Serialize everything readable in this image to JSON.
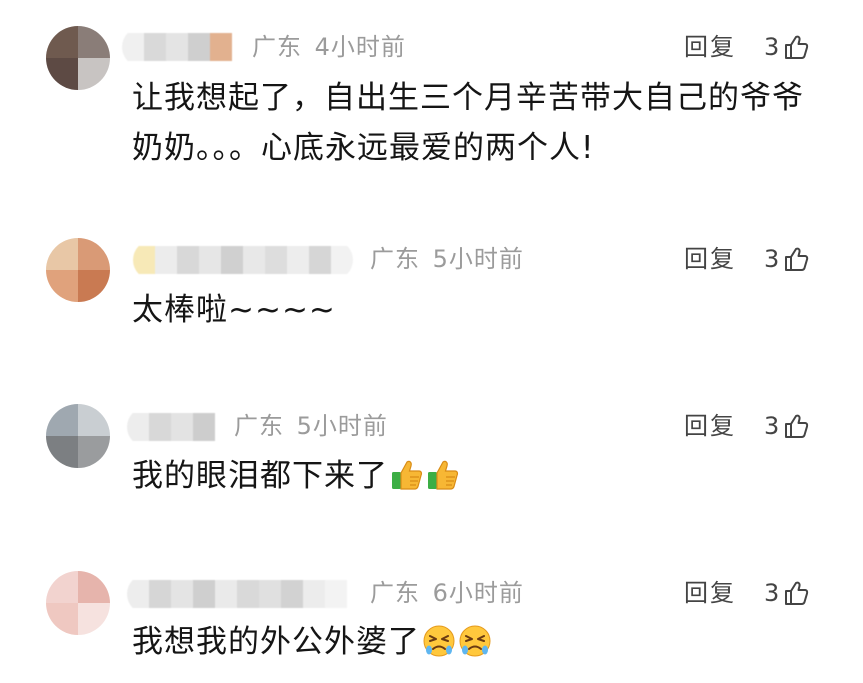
{
  "comments": [
    {
      "location": "广东",
      "time": "4小时前",
      "reply_label": "回复",
      "likes": "3",
      "text": "让我想起了，自出生三个月辛苦带大自己的爷爷奶奶。。。心底永远最爱的两个人!",
      "avatar_colors": [
        "#6f5a4f",
        "#8a7d78",
        "#5d4a44",
        "#c8c4c2"
      ],
      "emojis": []
    },
    {
      "location": "广东",
      "time": "5小时前",
      "reply_label": "回复",
      "likes": "3",
      "text": "太棒啦~~~~",
      "avatar_colors": [
        "#e8c7a6",
        "#d99a76",
        "#e0a27c",
        "#c97a52"
      ],
      "emojis": []
    },
    {
      "location": "广东",
      "time": "5小时前",
      "reply_label": "回复",
      "likes": "3",
      "text": "我的眼泪都下来了",
      "avatar_colors": [
        "#9fa8b0",
        "#c9ced2",
        "#7c7f82",
        "#9a9c9e"
      ],
      "emojis": [
        "thumbs-up-emoji",
        "thumbs-up-emoji"
      ]
    },
    {
      "location": "广东",
      "time": "6小时前",
      "reply_label": "回复",
      "likes": "3",
      "text": "我想我的外公外婆了",
      "avatar_colors": [
        "#f2d3cf",
        "#e6b4ac",
        "#efc8c1",
        "#f6e2df"
      ],
      "emojis": [
        "persevering-face-emoji",
        "persevering-face-emoji"
      ]
    }
  ],
  "icons": {
    "like": "thumbs-up-outline-icon"
  },
  "colors": {
    "meta_text": "#9b9b9b",
    "body_text": "#151515",
    "action_text": "#444444"
  }
}
